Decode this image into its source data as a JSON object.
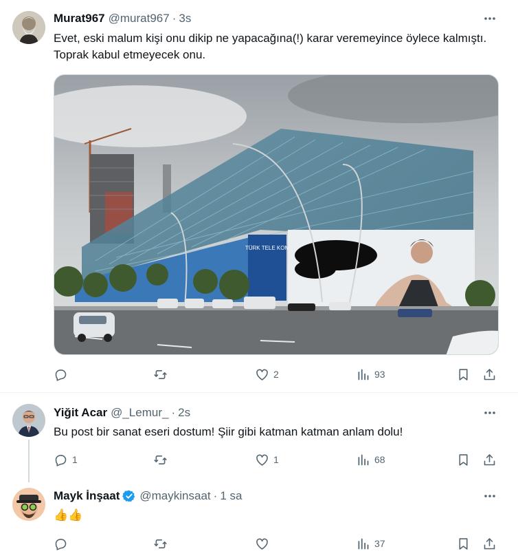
{
  "tweets": [
    {
      "name": "Murat967",
      "handle": "@murat967",
      "separator": "·",
      "time": "3s",
      "text": "Evet, eski malum kişi onu dikip ne yapacağına(!) karar veremeyince öylece kalmıştı. Toprak kabul etmeyecek onu.",
      "replies": "",
      "retweets": "",
      "likes": "2",
      "views": "93"
    },
    {
      "name": "Yiğit Acar",
      "handle": "@_Lemur_",
      "separator": "·",
      "time": "2s",
      "text": "Bu post bir sanat eseri dostum! Şiir gibi katman katman anlam dolu!",
      "replies": "1",
      "retweets": "",
      "likes": "1",
      "views": "68"
    },
    {
      "name": "Mayk İnşaat",
      "handle": "@maykinsaat",
      "separator": "·",
      "time": "1 sa",
      "text": "👍👍",
      "replies": "",
      "retweets": "",
      "likes": "",
      "views": "37"
    }
  ],
  "media": {
    "billboard_text": "TÜRK TELE KOM"
  },
  "colors": {
    "text": "#0f1419",
    "secondary": "#536471",
    "divider": "#eff3f4",
    "verified": "#1d9bf0"
  },
  "icons": [
    "more-icon",
    "reply-icon",
    "retweet-icon",
    "like-icon",
    "views-icon",
    "bookmark-icon",
    "share-icon",
    "verified-badge-icon"
  ]
}
